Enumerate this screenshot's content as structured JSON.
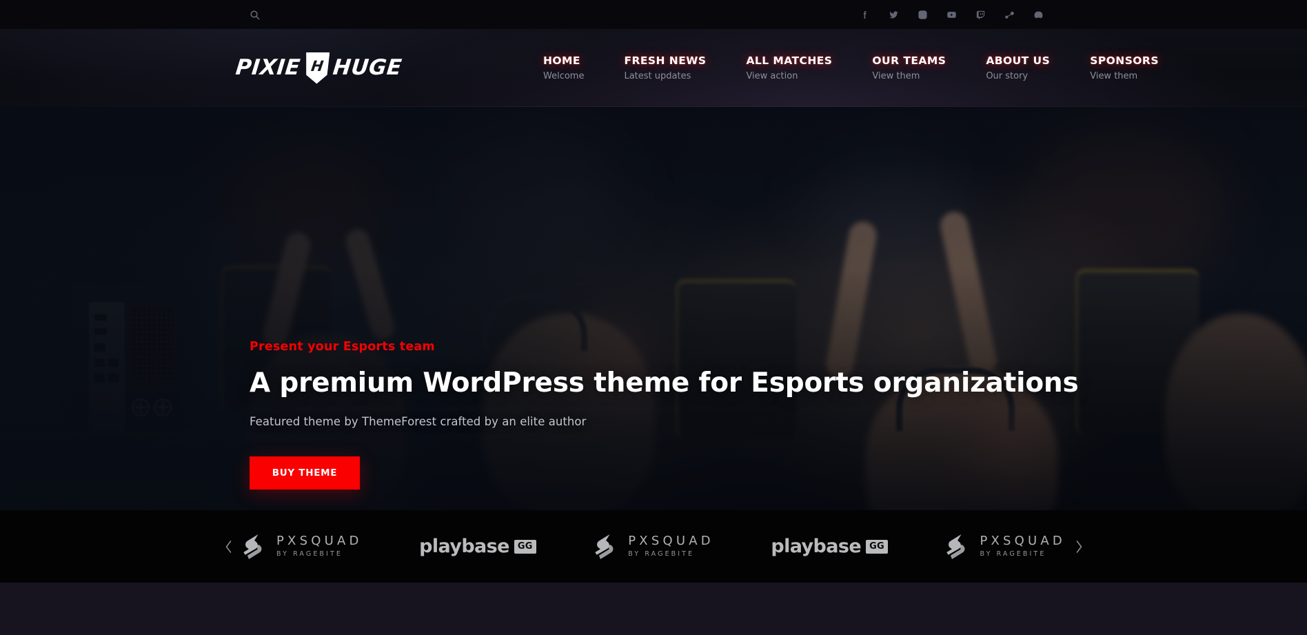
{
  "topbar": {
    "search_icon": "search-icon",
    "social": [
      {
        "name": "facebook",
        "label": "Facebook"
      },
      {
        "name": "twitter",
        "label": "Twitter"
      },
      {
        "name": "instagram",
        "label": "Instagram"
      },
      {
        "name": "youtube",
        "label": "YouTube"
      },
      {
        "name": "twitch",
        "label": "Twitch"
      },
      {
        "name": "steam",
        "label": "Steam"
      },
      {
        "name": "discord",
        "label": "Discord"
      }
    ]
  },
  "header": {
    "logo": {
      "first": "PIXIE",
      "mark": "H",
      "second": "HUGE"
    },
    "nav": [
      {
        "label": "HOME",
        "sub": "Welcome"
      },
      {
        "label": "FRESH NEWS",
        "sub": "Latest updates"
      },
      {
        "label": "ALL MATCHES",
        "sub": "View action"
      },
      {
        "label": "OUR TEAMS",
        "sub": "View them"
      },
      {
        "label": "ABOUT US",
        "sub": "Our story"
      },
      {
        "label": "SPONSORS",
        "sub": "View them"
      }
    ]
  },
  "hero": {
    "eyebrow": "Present your Esports team",
    "title": "A premium WordPress theme for Esports organizations",
    "subtitle": "Featured theme by ThemeForest crafted by an elite author",
    "cta_label": "BUY THEME"
  },
  "sponsors": {
    "prev_icon": "chevron-left-icon",
    "next_icon": "chevron-right-icon",
    "items": [
      {
        "type": "pxsquad",
        "name": "PXSQUAD",
        "tagline": "BY RAGEBITE"
      },
      {
        "type": "playbase",
        "name": "playbase",
        "badge": "GG"
      },
      {
        "type": "pxsquad",
        "name": "PXSQUAD",
        "tagline": "BY RAGEBITE"
      },
      {
        "type": "playbase",
        "name": "playbase",
        "badge": "GG"
      },
      {
        "type": "pxsquad",
        "name": "PXSQUAD",
        "tagline": "BY RAGEBITE"
      }
    ]
  },
  "colors": {
    "accent_red": "#fa0000",
    "topbar_bg": "#08080c",
    "header_bg": "#0d0d14",
    "sponsors_bg": "#030304",
    "bottom_bg": "#17141f"
  }
}
